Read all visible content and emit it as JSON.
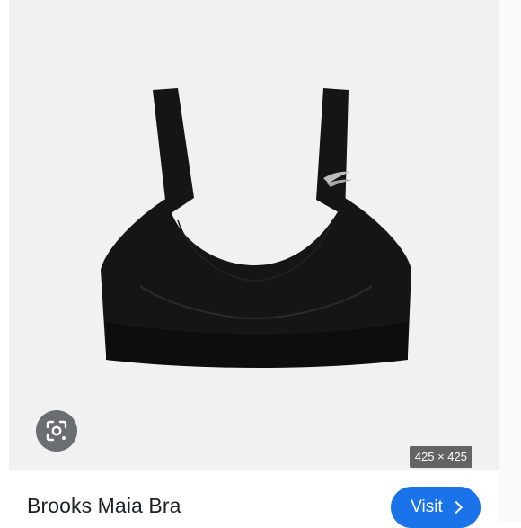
{
  "product": {
    "title": "Brooks Maia Bra",
    "image_alt": "black sports bra"
  },
  "image_meta": {
    "dimensions": "425 × 425"
  },
  "actions": {
    "visit_label": "Visit",
    "visit_icon": "chevron-right-icon",
    "lens_icon": "lens-search-icon"
  },
  "colors": {
    "accent": "#1a73e8",
    "panel_bg": "#f1f1f1",
    "product": "#151515"
  }
}
